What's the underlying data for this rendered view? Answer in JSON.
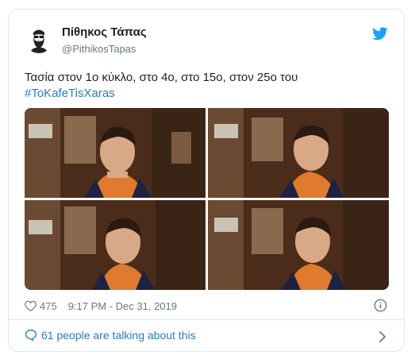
{
  "author": {
    "name": "Πίθηκος Τάπας",
    "handle": "@PithikosTapas"
  },
  "tweet": {
    "text": "Τασία στον 1ο κύκλο, στο 4ο, στο 15ο, στον 25ο του",
    "hashtag": "#ToKafeTisXaras"
  },
  "media": {
    "tiles": [
      "tile-1",
      "tile-2",
      "tile-3",
      "tile-4"
    ]
  },
  "meta": {
    "likes": "475",
    "timestamp": "9:17 PM - Dec 31, 2019"
  },
  "footer": {
    "talking": "61 people are talking about this"
  },
  "colors": {
    "link": "#2b7bb9",
    "muted": "#697882",
    "twitter_blue": "#1da1f2",
    "border": "#e1e8ed"
  },
  "icons": [
    "avatar-bearded-man",
    "twitter-bird-icon",
    "heart-icon",
    "info-icon",
    "speech-bubble-icon",
    "chevron-right-icon"
  ]
}
